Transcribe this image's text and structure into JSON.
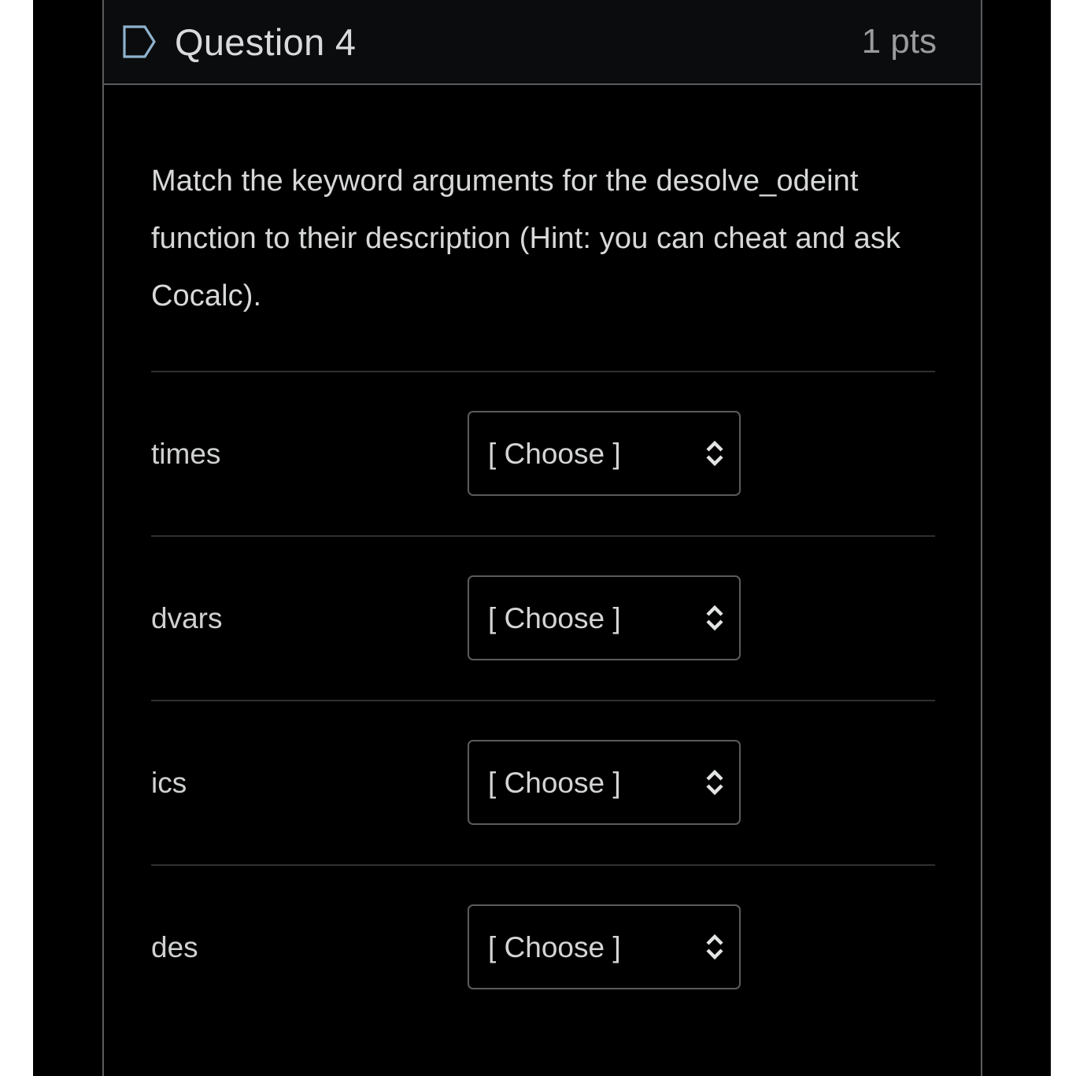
{
  "header": {
    "flag_icon": "flag-outline-icon",
    "title": "Question 4",
    "points": "1 pts"
  },
  "body": {
    "prompt": "Match the keyword arguments for the desolve_odeint function to their description (Hint: you can cheat and ask Cocalc).",
    "matches": [
      {
        "term": "times",
        "selected": "[ Choose ]",
        "chevron_icon": "chevron-up-down-icon"
      },
      {
        "term": "dvars",
        "selected": "[ Choose ]",
        "chevron_icon": "chevron-up-down-icon"
      },
      {
        "term": "ics",
        "selected": "[ Choose ]",
        "chevron_icon": "chevron-up-down-icon"
      },
      {
        "term": "des",
        "selected": "[ Choose ]",
        "chevron_icon": "chevron-up-down-icon"
      }
    ]
  },
  "colors": {
    "page_background": "#000000",
    "card_border": "#5b5c5e",
    "header_background": "#0b0c0d",
    "title_text": "#d9dadb",
    "points_text": "#9a9b9d",
    "body_text": "#d7d8d9",
    "row_divider": "#2e2f30",
    "select_border": "#5a5b5d",
    "flag_icon_stroke": "#8fb2cc",
    "gutter": "#ffffff"
  }
}
